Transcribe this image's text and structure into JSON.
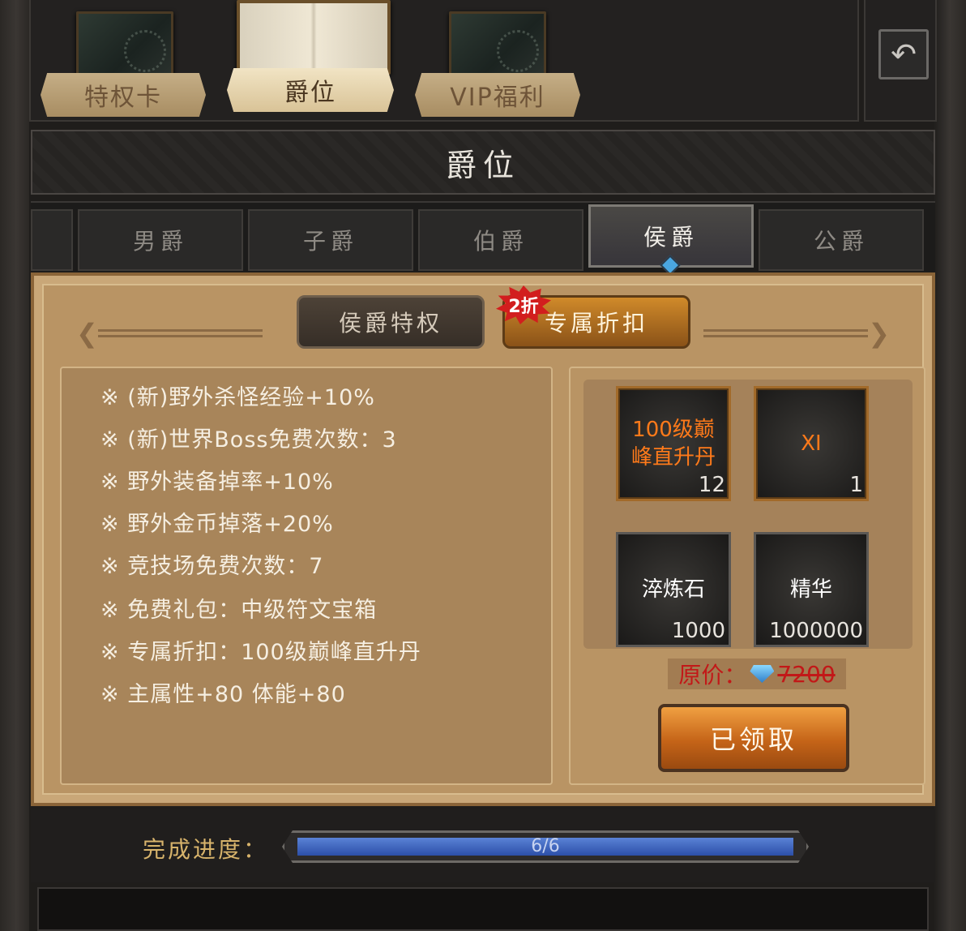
{
  "top_tabs": [
    {
      "label": "特权卡",
      "active": false
    },
    {
      "label": "爵位",
      "active": true
    },
    {
      "label": "VIP福利",
      "active": false
    }
  ],
  "back_icon": "back-arrow-icon",
  "title": "爵位",
  "ranks": [
    {
      "label": "",
      "active": false
    },
    {
      "label": "男爵",
      "active": false
    },
    {
      "label": "子爵",
      "active": false
    },
    {
      "label": "伯爵",
      "active": false
    },
    {
      "label": "侯爵",
      "active": true
    },
    {
      "label": "公爵",
      "active": false
    }
  ],
  "sub_tabs": {
    "privilege": "侯爵特权",
    "discount": "专属折扣",
    "badge": "2折"
  },
  "perks": [
    "※ (新)野外杀怪经验+10%",
    "※ (新)世界Boss免费次数：3",
    "※ 野外装备掉率+10%",
    "※ 野外金币掉落+20%",
    "※ 竞技场免费次数：7",
    "※ 免费礼包：中级符文宝箱",
    "※ 专属折扣：100级巅峰直升丹",
    "※ 主属性+80 体能+80"
  ],
  "rewards": [
    {
      "name": "100级巅峰直升丹",
      "count": "12",
      "rarity": "gold"
    },
    {
      "name": "XI",
      "count": "1",
      "rarity": "gold"
    },
    {
      "name": "淬炼石",
      "count": "1000",
      "rarity": "normal"
    },
    {
      "name": "精华",
      "count": "1000000",
      "rarity": "normal"
    }
  ],
  "price": {
    "label": "原价：",
    "value": "7200",
    "currency_icon": "diamond-icon"
  },
  "claim_button": "已领取",
  "progress": {
    "label": "完成进度：",
    "text": "6/6",
    "fraction": 1.0
  },
  "colors": {
    "accent_orange": "#c56418",
    "price_red": "#c21818",
    "progress_blue": "#2c4fa8",
    "parchment": "#b99464"
  }
}
